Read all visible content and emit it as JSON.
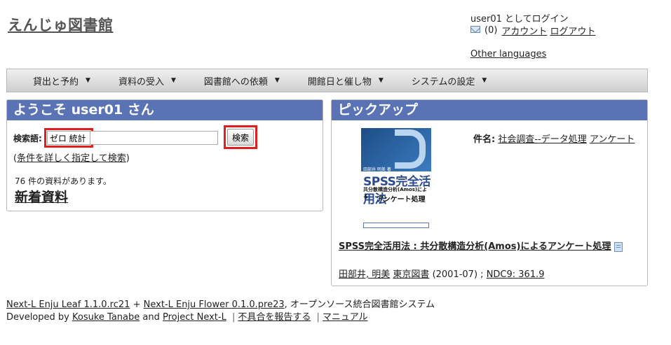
{
  "site": {
    "title": "えんじゅ図書館"
  },
  "user": {
    "login_text": "user01 としてログイン",
    "messages": "(0)",
    "account_link": "アカウント",
    "logout_link": "ログアウト",
    "other_languages": "Other languages"
  },
  "nav": {
    "items": [
      {
        "label": "貸出と予約"
      },
      {
        "label": "資料の受入"
      },
      {
        "label": "図書館への依頼"
      },
      {
        "label": "開館日と催し物"
      },
      {
        "label": "システムの設定"
      }
    ],
    "caret": "▼"
  },
  "welcome": {
    "heading": "ようこそ user01 さん",
    "search_label": "検索語:",
    "search_value": "ゼロ 統計",
    "search_button": "検索",
    "advanced_open": "(",
    "advanced_link": "条件を詳しく指定して検索",
    "advanced_close": ")",
    "count_text": "76 件の資料があります。",
    "new_items": "新着資料"
  },
  "pickup": {
    "heading": "ピックアップ",
    "subject_label": "件名:",
    "subjects": [
      "社会調査--データ処理",
      "アンケート"
    ],
    "book_title": "SPSS完全活用法 : 共分散構造分析(Amos)によるアンケート処理",
    "author": "田部井, 明美",
    "publisher": "東京図書",
    "date": "(2001-07) ;",
    "ndc": "NDC9: 361.9",
    "cover": {
      "author_small": "田部井 明美 著",
      "spss": "SPSS完全活用法",
      "sub1": "共分散構造分析(Amos)による",
      "sub2": "アンケート処理"
    }
  },
  "footer": {
    "leaf": "Next-L Enju Leaf 1.1.0.rc21",
    "plus": "+",
    "flower": "Next-L Enju Flower 0.1.0.pre23",
    "desc": ", オープンソース統合図書館システム",
    "developed_by": "Developed by",
    "kosuke": "Kosuke Tanabe",
    "and": "and",
    "project": "Project Next-L",
    "pipe": "|",
    "report": "不具合を報告する",
    "manual": "マニュアル"
  }
}
